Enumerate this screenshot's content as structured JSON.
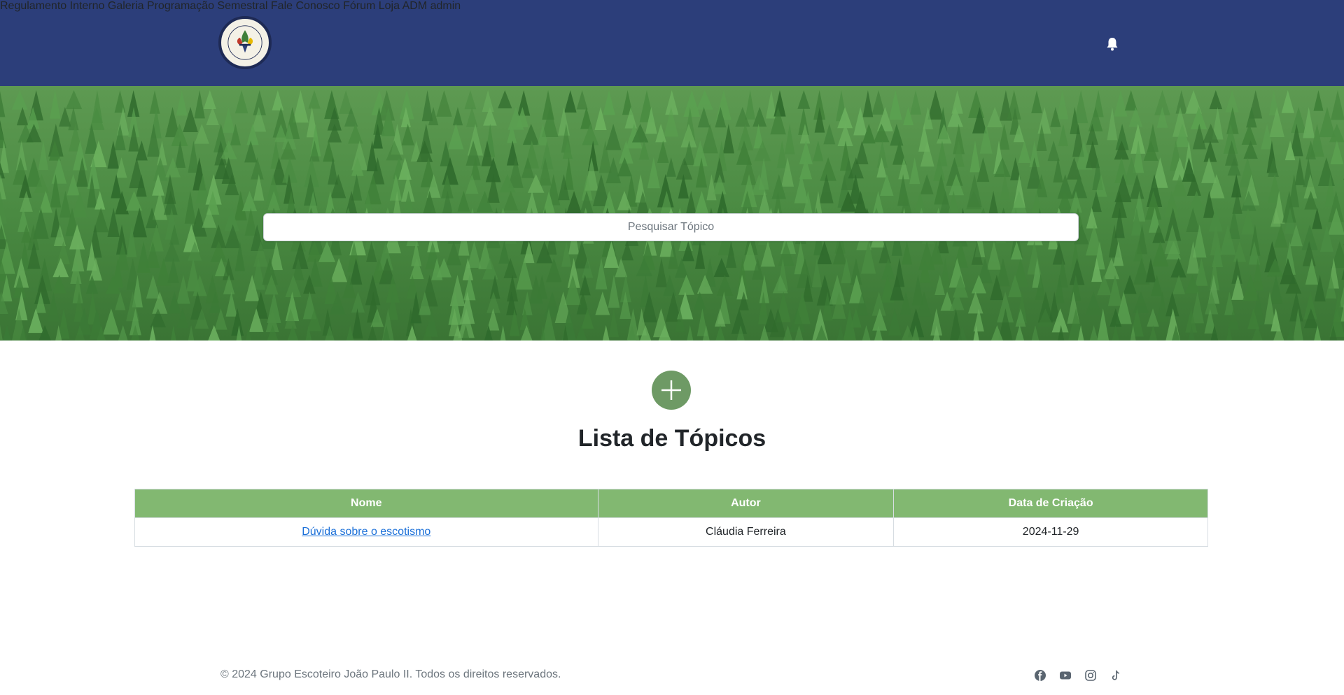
{
  "header": {
    "logo_alt": "G. E. JOÃO PAULO II · 293",
    "nav": [
      {
        "label": "Regulamento Interno"
      },
      {
        "label": "Galeria"
      },
      {
        "label": "Programação Semestral"
      },
      {
        "label": "Fale Conosco"
      },
      {
        "label": "Fórum"
      },
      {
        "label": "Loja"
      },
      {
        "label": "ADM"
      },
      {
        "label": "admin"
      }
    ]
  },
  "search": {
    "placeholder": "Pesquisar Tópico",
    "value": ""
  },
  "main": {
    "title": "Lista de Tópicos",
    "table": {
      "headers": [
        "Nome",
        "Autor",
        "Data de Criação"
      ],
      "rows": [
        {
          "name": "Dúvida sobre o escotismo",
          "author": "Cláudia Ferreira",
          "date": "2024-11-29"
        }
      ]
    }
  },
  "footer": {
    "copyright": "© 2024 Grupo Escoteiro João Paulo II. Todos os direitos reservados.",
    "social_icons": [
      "facebook-icon",
      "youtube-icon",
      "instagram-icon",
      "tiktok-icon"
    ]
  },
  "colors": {
    "header_bg": "#2c3e7a",
    "table_header_bg": "#82b871",
    "add_button_bg": "#6e9a65",
    "link": "#1a6fd8"
  }
}
